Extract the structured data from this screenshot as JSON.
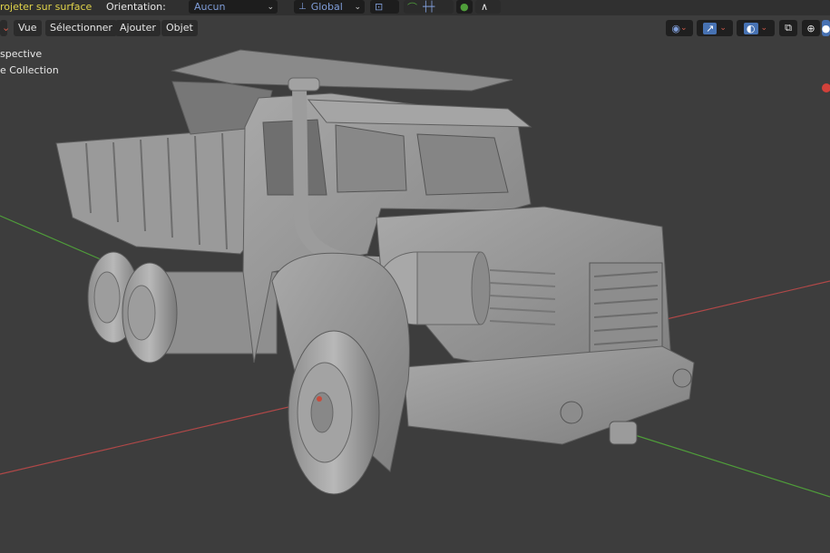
{
  "topbar": {
    "project_label": "rojeter sur surface",
    "orientation_label": "Orientation:",
    "orientation_value": "Aucun",
    "transform_value": "Global"
  },
  "header": {
    "menu": [
      {
        "id": "vue",
        "label": "Vue"
      },
      {
        "id": "selectionner",
        "label": "Sélectionner"
      },
      {
        "id": "ajouter",
        "label": "Ajouter"
      },
      {
        "id": "objet",
        "label": "Objet"
      }
    ]
  },
  "viewport": {
    "view_name": "spective",
    "collection": "e Collection"
  },
  "colors": {
    "background": "#3d3d3d",
    "x_axis": "#b04848",
    "y_axis": "#4f9d3a",
    "accent": "#4772b3",
    "orientation_text": "#7f9dd8",
    "project_text": "#e0d34a"
  },
  "icons": [
    "chevron-down-icon",
    "transform-global-icon",
    "pivot-icon",
    "snap-icon",
    "snap-increment-icon",
    "proportional-icon",
    "falloff-icon",
    "visibility-icon",
    "gizmo-icon",
    "overlay-icon",
    "xray-icon",
    "wireframe-icon",
    "solid-shading-icon"
  ]
}
